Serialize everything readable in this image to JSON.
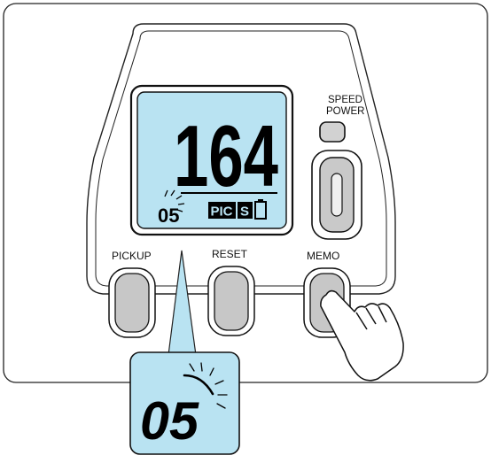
{
  "device": {
    "speed_power_label_line1": "SPEED",
    "speed_power_label_line2": "POWER",
    "pickup_label": "PICKUP",
    "reset_label": "RESET",
    "memo_label": "MEMO"
  },
  "display": {
    "main_value": "164",
    "memory_number": "05",
    "pic_label": "PIC",
    "s_label": "S",
    "lcd_color": "#b9e3f2"
  },
  "callout": {
    "memory_number": "05"
  }
}
